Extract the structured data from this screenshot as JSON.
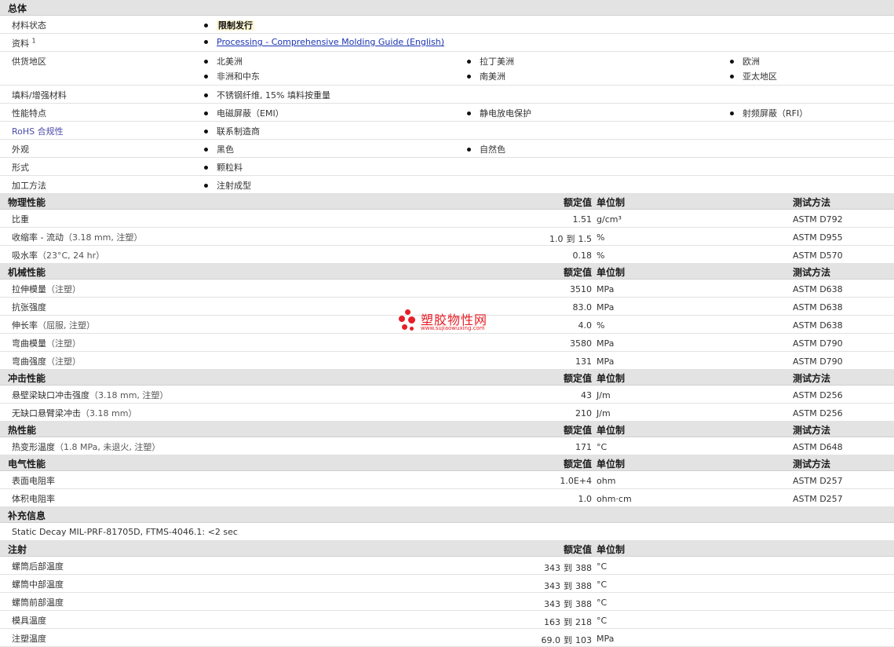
{
  "general": {
    "title": "总体",
    "material_status": {
      "label": "材料状态",
      "value": "限制发行"
    },
    "literature": {
      "label": "资料",
      "sup": "1",
      "link": "Processing - Comprehensive Molding Guide (English)"
    },
    "availability": {
      "label": "供货地区",
      "items": [
        "北美洲",
        "拉丁美洲",
        "欧洲",
        "非洲和中东",
        "南美洲",
        "亚太地区"
      ]
    },
    "filler": {
      "label": "填料/增强材料",
      "value": "不锈钢纤维, 15% 填料按重量"
    },
    "features": {
      "label": "性能特点",
      "items": [
        "电磁屏蔽（EMI）",
        "静电放电保护",
        "射频屏蔽（RFI）"
      ]
    },
    "rohs": {
      "label": "RoHS 合规性",
      "value": "联系制造商"
    },
    "appearance": {
      "label": "外观",
      "items": [
        "黑色",
        "自然色"
      ]
    },
    "forms": {
      "label": "形式",
      "value": "颗粒料"
    },
    "processing": {
      "label": "加工方法",
      "value": "注射成型"
    }
  },
  "headers": {
    "value": "额定值",
    "unit": "单位制",
    "test": "测试方法"
  },
  "physical": {
    "title": "物理性能",
    "rows": [
      {
        "label": "比重",
        "cond": "",
        "value": "1.51",
        "unit": "g/cm³",
        "test": "ASTM D792"
      },
      {
        "label": "收缩率 - 流动",
        "cond": "（3.18 mm, 注塑）",
        "lo": "1.0",
        "to": "到",
        "hi": "1.5",
        "unit": "%",
        "test": "ASTM D955"
      },
      {
        "label": "吸水率",
        "cond": "（23°C, 24 hr）",
        "value": "0.18",
        "unit": "%",
        "test": "ASTM D570"
      }
    ]
  },
  "mechanical": {
    "title": "机械性能",
    "rows": [
      {
        "label": "拉伸模量",
        "cond": "（注塑）",
        "value": "3510",
        "unit": "MPa",
        "test": "ASTM D638"
      },
      {
        "label": "抗张强度",
        "cond": "",
        "value": "83.0",
        "unit": "MPa",
        "test": "ASTM D638"
      },
      {
        "label": "伸长率",
        "cond": "（屈服, 注塑）",
        "value": "4.0",
        "unit": "%",
        "test": "ASTM D638"
      },
      {
        "label": "弯曲模量",
        "cond": "（注塑）",
        "value": "3580",
        "unit": "MPa",
        "test": "ASTM D790"
      },
      {
        "label": "弯曲强度",
        "cond": "（注塑）",
        "value": "131",
        "unit": "MPa",
        "test": "ASTM D790"
      }
    ]
  },
  "impact": {
    "title": "冲击性能",
    "rows": [
      {
        "label": "悬壁梁缺口冲击强度",
        "cond": "（3.18 mm, 注塑）",
        "value": "43",
        "unit": "J/m",
        "test": "ASTM D256"
      },
      {
        "label": "无缺口悬臂梁冲击",
        "cond": "（3.18 mm）",
        "value": "210",
        "unit": "J/m",
        "test": "ASTM D256"
      }
    ]
  },
  "thermal": {
    "title": "热性能",
    "rows": [
      {
        "label": "热变形温度",
        "cond": "（1.8 MPa, 未退火, 注塑）",
        "value": "171",
        "unit": "°C",
        "test": "ASTM D648"
      }
    ]
  },
  "electrical": {
    "title": "电气性能",
    "rows": [
      {
        "label": "表面电阻率",
        "cond": "",
        "value": "1.0E+4",
        "unit": "ohm",
        "test": "ASTM D257"
      },
      {
        "label": "体积电阻率",
        "cond": "",
        "value": "1.0",
        "unit": "ohm·cm",
        "test": "ASTM D257"
      }
    ]
  },
  "supplement": {
    "title": "补充信息",
    "note": "Static Decay MIL-PRF-81705D, FTMS-4046.1: <2 sec"
  },
  "injection": {
    "title": "注射",
    "rows": [
      {
        "label": "螺筒后部温度",
        "lo": "343",
        "to": "到",
        "hi": "388",
        "unit": "°C"
      },
      {
        "label": "螺筒中部温度",
        "lo": "343",
        "to": "到",
        "hi": "388",
        "unit": "°C"
      },
      {
        "label": "螺筒前部温度",
        "lo": "343",
        "to": "到",
        "hi": "388",
        "unit": "°C"
      },
      {
        "label": "模具温度",
        "lo": "163",
        "to": "到",
        "hi": "218",
        "unit": "°C"
      },
      {
        "label": "注塑温度",
        "lo": "69.0",
        "to": "到",
        "hi": "103",
        "unit": "MPa"
      }
    ]
  },
  "watermark": {
    "text": "塑胶物性网",
    "url": "www.sujiaowuxing.com",
    "color": "#e61e25"
  }
}
